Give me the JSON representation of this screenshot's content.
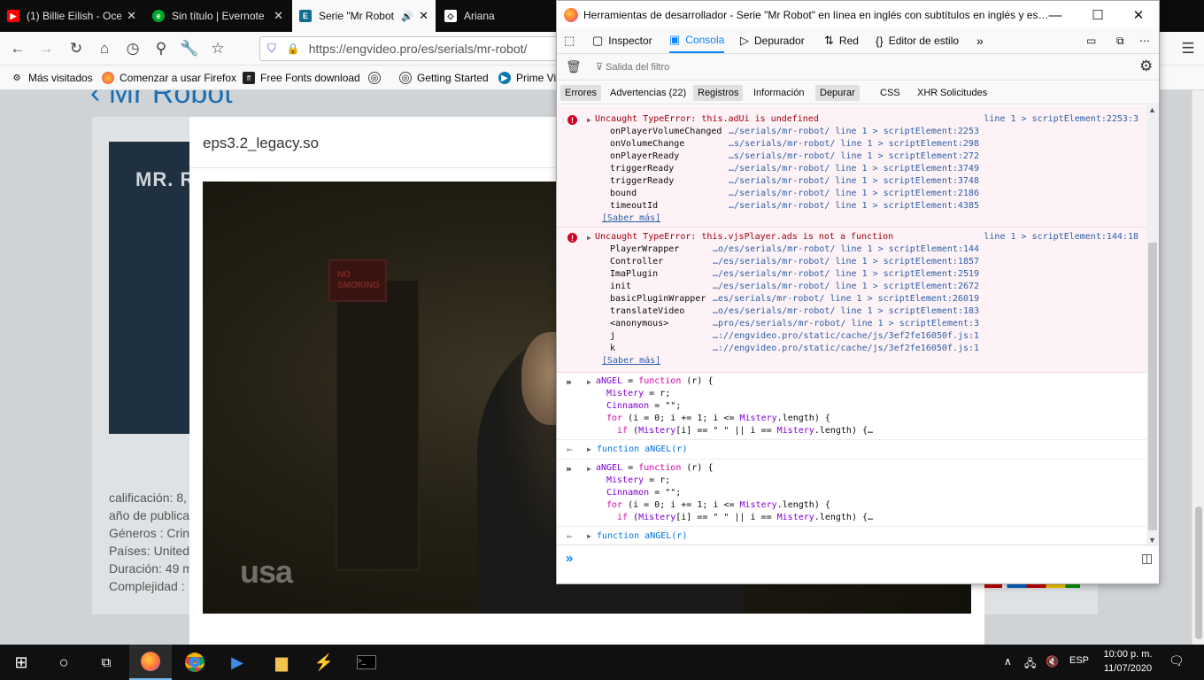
{
  "tabs": [
    {
      "title": "(1) Billie Eilish - Oce",
      "favicon": "youtube-icon",
      "color": "#ff0000"
    },
    {
      "title": "Sin título | Evernote",
      "favicon": "evernote-icon",
      "color": "#00a82d"
    },
    {
      "title": "Serie \"Mr Robot",
      "favicon": "engvideo-icon",
      "color": "#0e6e8f",
      "active": true
    },
    {
      "title": "Ariana",
      "favicon": "codepen-icon",
      "color": "#ffffff"
    }
  ],
  "navbar": {
    "url": "https://engvideo.pro/es/serials/mr-robot/"
  },
  "bookmarks": [
    {
      "label": "Más visitados",
      "icon": "gear-icon"
    },
    {
      "label": "Comenzar a usar Firefox",
      "icon": "firefox-icon"
    },
    {
      "label": "Free Fonts download",
      "icon": "fonts-icon"
    },
    {
      "label": "",
      "icon": "globe-icon"
    },
    {
      "label": "Getting Started",
      "icon": "globe-icon"
    },
    {
      "label": "Prime Vi",
      "icon": "prime-icon"
    }
  ],
  "page": {
    "title": "Mr Robot",
    "poster_text": "MR. R",
    "info": [
      "calificación: 8,",
      "año de publica",
      "Géneros : Crin",
      "Países: United",
      "Duración: 49 m",
      "Complejidad :"
    ],
    "modal_title": "eps3.2_legacy.so",
    "video_logo": "usa",
    "video_sign": "NO SMOKING"
  },
  "devtools": {
    "title": "Herramientas de desarrollador - Serie \"Mr Robot\" en línea en inglés con subtítulos en inglés y es…",
    "toolbar": [
      "Inspector",
      "Consola",
      "Depurador",
      "Red",
      "Editor de estilo"
    ],
    "filter_placeholder": "Salida del filtro",
    "categories": [
      "Errores",
      "Advertencias (22)",
      "Registros",
      "Información",
      "Depurar",
      "CSS",
      "XHR",
      "Solicitudes"
    ],
    "errors": [
      {
        "message": "Uncaught TypeError: this.adUi is undefined",
        "location": "line 1 > scriptElement:2253:3",
        "frames": [
          {
            "fn": "onPlayerVolumeChanged",
            "loc": "…/serials/mr-robot/ line 1 > scriptElement:2253"
          },
          {
            "fn": "onVolumeChange",
            "loc": "…s/serials/mr-robot/ line 1 > scriptElement:298"
          },
          {
            "fn": "onPlayerReady",
            "loc": "…s/serials/mr-robot/ line 1 > scriptElement:272"
          },
          {
            "fn": "triggerReady",
            "loc": "…/serials/mr-robot/ line 1 > scriptElement:3749"
          },
          {
            "fn": "triggerReady",
            "loc": "…/serials/mr-robot/ line 1 > scriptElement:3748"
          },
          {
            "fn": "bound",
            "loc": "…/serials/mr-robot/ line 1 > scriptElement:2186"
          },
          {
            "fn": "timeoutId",
            "loc": "…/serials/mr-robot/ line 1 > scriptElement:4385"
          }
        ],
        "learn_more": "[Saber más]"
      },
      {
        "message": "Uncaught TypeError: this.vjsPlayer.ads is not a function",
        "location": "line 1 > scriptElement:144:18",
        "frames": [
          {
            "fn": "PlayerWrapper",
            "loc": "…o/es/serials/mr-robot/ line 1 > scriptElement:144"
          },
          {
            "fn": "Controller",
            "loc": "…/es/serials/mr-robot/ line 1 > scriptElement:1857"
          },
          {
            "fn": "ImaPlugin",
            "loc": "…/es/serials/mr-robot/ line 1 > scriptElement:2519"
          },
          {
            "fn": "init",
            "loc": "…/es/serials/mr-robot/ line 1 > scriptElement:2672"
          },
          {
            "fn": "basicPluginWrapper",
            "loc": "…es/serials/mr-robot/ line 1 > scriptElement:26019"
          },
          {
            "fn": "translateVideo",
            "loc": "…o/es/serials/mr-robot/ line 1 > scriptElement:183"
          },
          {
            "fn": "<anonymous>",
            "loc": "…pro/es/serials/mr-robot/ line 1 > scriptElement:3"
          },
          {
            "fn": "j",
            "loc": "…://engvideo.pro/static/cache/js/3ef2fe16050f.js:1"
          },
          {
            "fn": "k",
            "loc": "…://engvideo.pro/static/cache/js/3ef2fe16050f.js:1"
          }
        ],
        "learn_more": "[Saber más]"
      }
    ],
    "evaluations": [
      {
        "result": "function aNGEL(r)"
      },
      {
        "result": "function aNGEL(r)"
      }
    ]
  },
  "taskbar": {
    "lang": "ESP",
    "time": "10:00 p. m.",
    "date": "11/07/2020"
  }
}
